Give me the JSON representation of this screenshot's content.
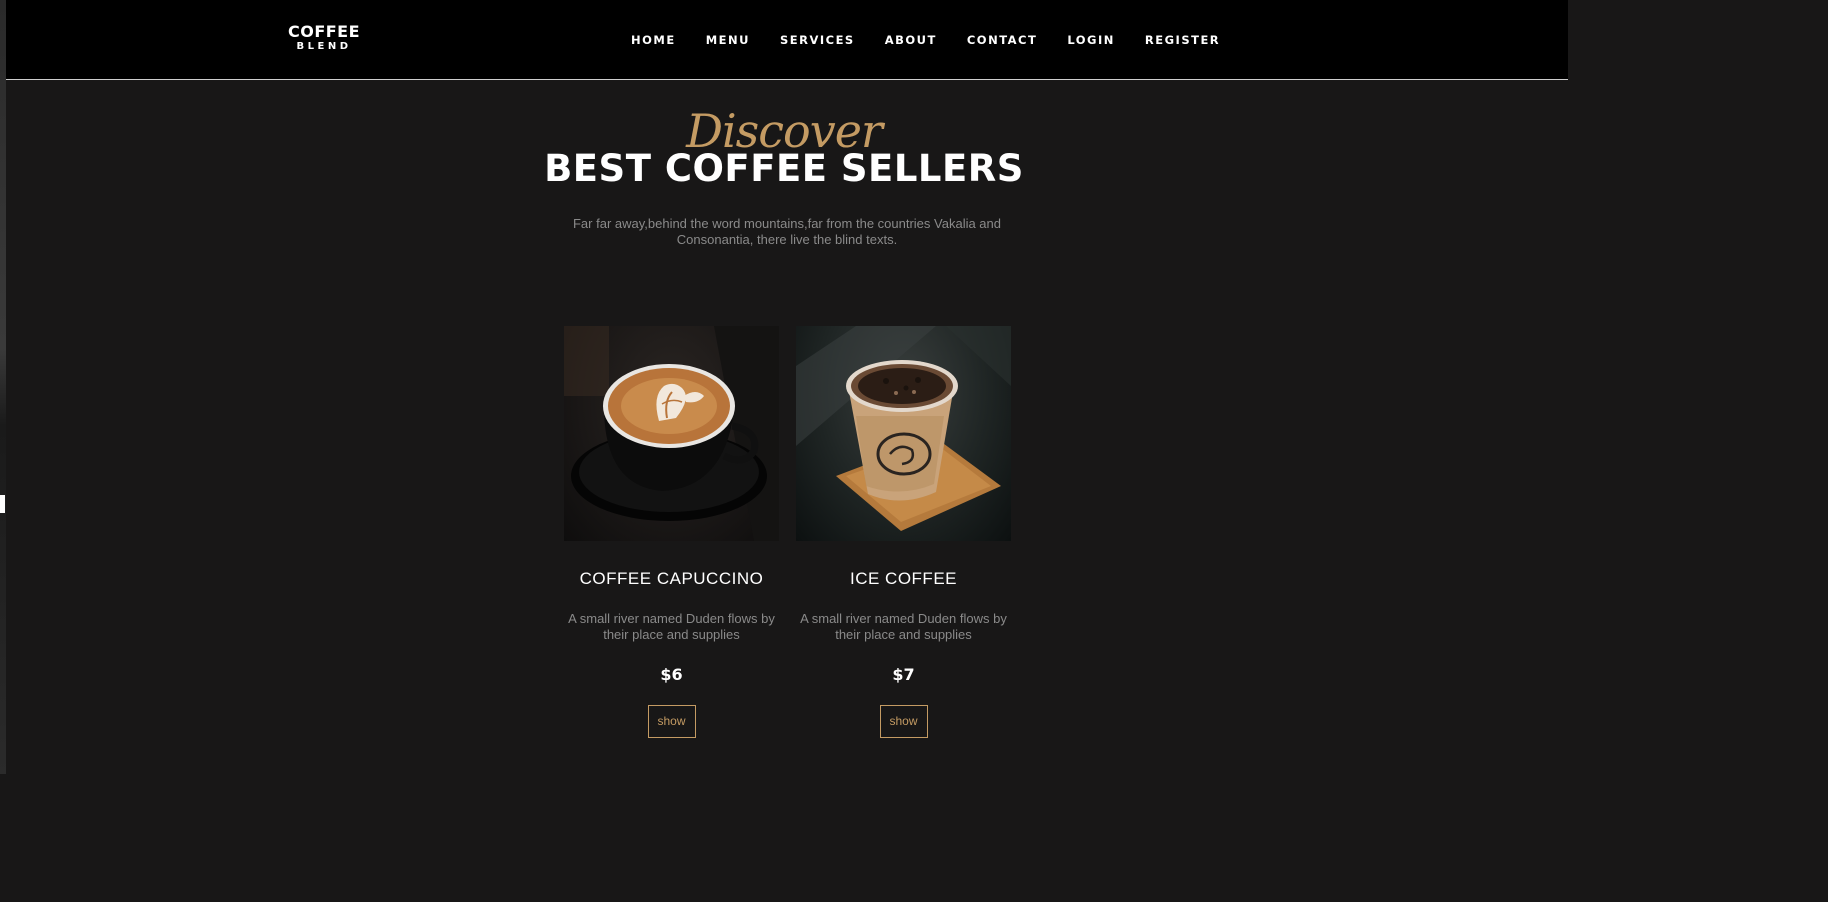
{
  "brand": {
    "line1": "COFFEE",
    "line2": "BLEND"
  },
  "nav": {
    "items": [
      "HOME",
      "MENU",
      "SERVICES",
      "ABOUT",
      "CONTACT",
      "LOGIN",
      "REGISTER"
    ]
  },
  "hero": {
    "subheading": "Discover",
    "heading": "BEST COFFEE SELLERS",
    "lead": "Far far away,behind the word mountains,far from the countries Vakalia and Consonantia, there live the blind texts."
  },
  "products": [
    {
      "name": "COFFEE CAPUCCINO",
      "description": "A small river named Duden flows by their place and supplies",
      "price": "$6",
      "button": "show",
      "image": "cappuccino-cup-photo"
    },
    {
      "name": "ICE COFFEE",
      "description": "A small river named Duden flows by their place and supplies",
      "price": "$7",
      "button": "show",
      "image": "iced-coffee-cup-photo"
    }
  ],
  "colors": {
    "accent": "#c49b63",
    "background": "#181717",
    "navbar": "#000000",
    "muted_text": "#8a8a8a"
  }
}
